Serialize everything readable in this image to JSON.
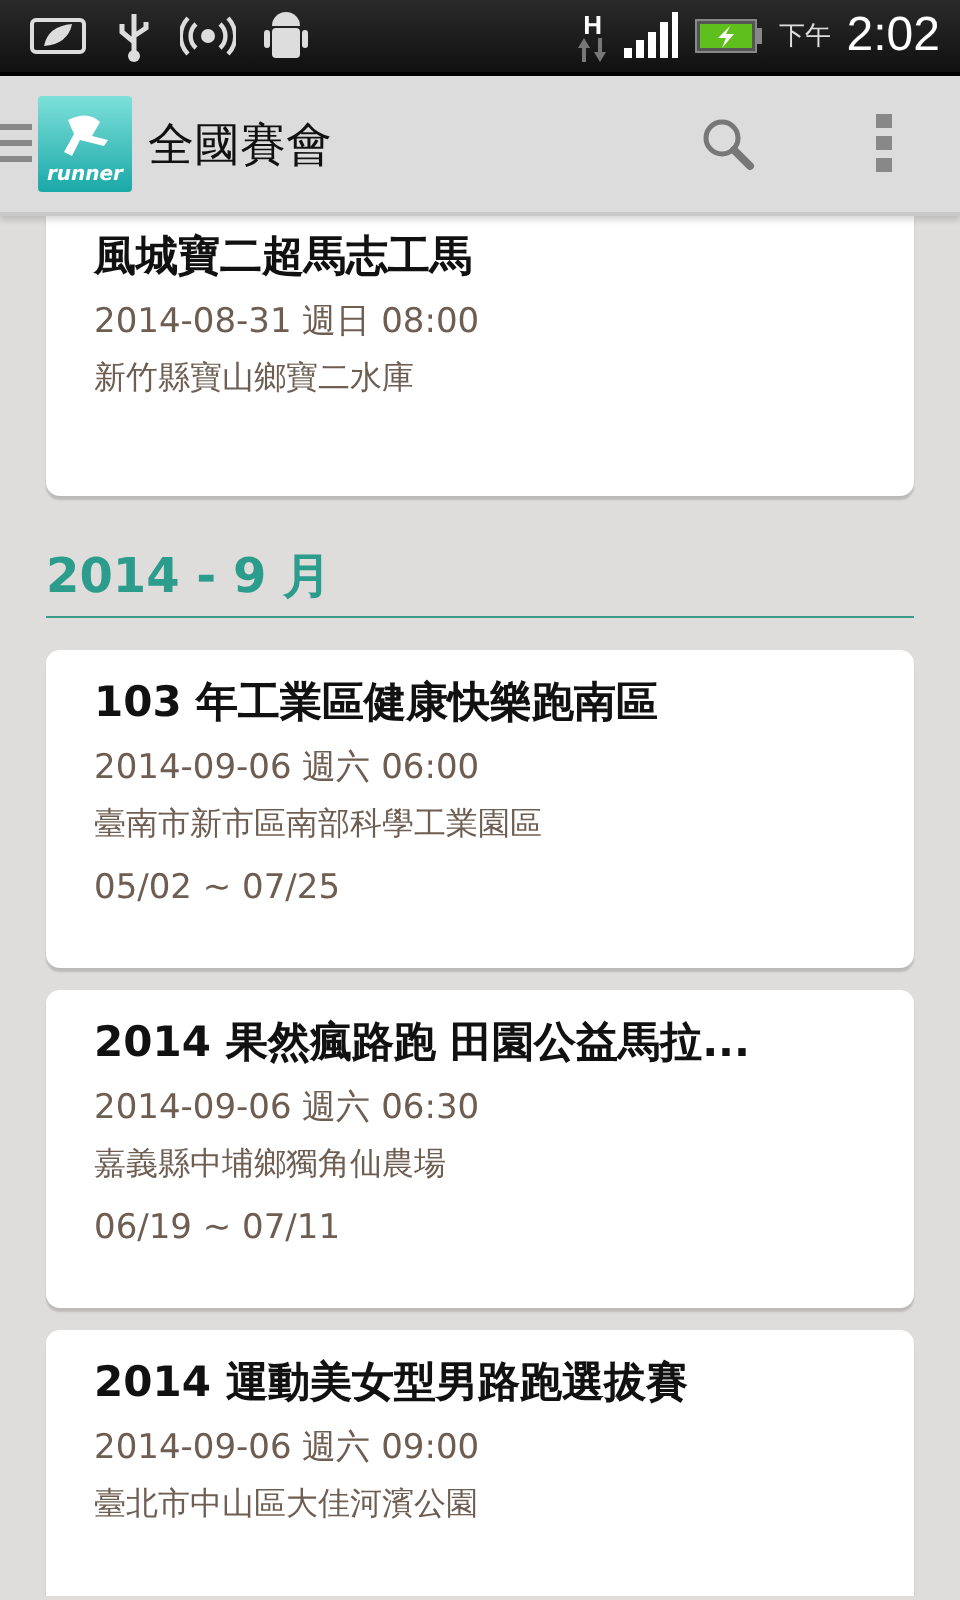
{
  "status_bar": {
    "network_type": "H",
    "period": "下午",
    "time": "2:02"
  },
  "app_bar": {
    "logo_text": "runner",
    "title": "全國賽會"
  },
  "sections": [
    {
      "events": [
        {
          "title": "風城寶二超馬志工馬",
          "datetime": "2014-08-31 週日 08:00",
          "location": "新竹縣寶山鄉寶二水庫"
        }
      ]
    },
    {
      "heading": "2014 - 9 月",
      "events": [
        {
          "title": "103 年工業區健康快樂跑南區",
          "datetime": "2014-09-06 週六 06:00",
          "location": "臺南市新市區南部科學工業園區",
          "registration": "05/02 ~ 07/25"
        },
        {
          "title": "2014 果然瘋路跑 田園公益馬拉...",
          "datetime": "2014-09-06 週六 06:30",
          "location": "嘉義縣中埔鄉獨角仙農場",
          "registration": "06/19 ~ 07/11"
        },
        {
          "title": "2014 運動美女型男路跑選拔賽",
          "datetime": "2014-09-06 週六 09:00",
          "location": "臺北市中山區大佳河濱公園"
        }
      ]
    }
  ]
}
